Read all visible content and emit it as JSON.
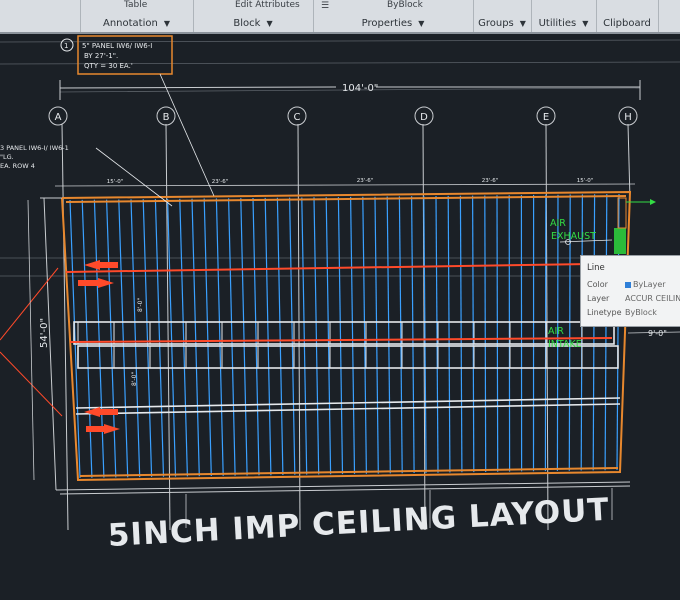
{
  "ribbon": {
    "groups": [
      {
        "label": "Annotation"
      },
      {
        "label": "Block"
      },
      {
        "label": "Properties"
      },
      {
        "label": "Groups"
      },
      {
        "label": "Utilities"
      },
      {
        "label": "Clipboard"
      }
    ],
    "table_label": "Table",
    "edit_attributes_label": "Edit Attributes",
    "byblock_label": "ByBlock"
  },
  "drawing": {
    "callout_1": {
      "number": "1",
      "line1": "5\" PANEL IW6/ IW6-I",
      "line2": "BY 27'-1\".",
      "line3": "QTY = 30 EA.'"
    },
    "callout_left": {
      "line1": "3 PANEL IW6-I/ IW6-1",
      "line2": "\"LG.",
      "line3": "EA. ROW 4"
    },
    "overall_width": "104'-0\"",
    "overall_height": "54'-0\"",
    "right_dim": "9'-0\"",
    "gridlines": [
      "A",
      "B",
      "C",
      "D",
      "E",
      "H"
    ],
    "segment_dims": [
      "15'-0\"",
      "23'-6\"",
      "23'-6\"",
      "23'-6\"",
      "15'-0\""
    ],
    "air_exhaust": {
      "line1": "AIR",
      "line2": "EXHAUST"
    },
    "air_intake": {
      "line1": "AIR",
      "line2": "INTAKE"
    }
  },
  "tooltip": {
    "title": "Line",
    "rows": [
      {
        "key": "Color",
        "value": "ByLayer"
      },
      {
        "key": "Layer",
        "value": "ACCUR CEILIN"
      },
      {
        "key": "Linetype",
        "value": "ByBlock"
      }
    ]
  },
  "title": "5INCH IMP CEILING LAYOUT",
  "colors": {
    "background": "#1b2026",
    "panel_lines": "#3aa0ff",
    "perimeter": "#e8882e",
    "arrows": "#ff4a2a",
    "grid_lines": "#c9ccd0",
    "annotation_green": "#33dd44"
  }
}
